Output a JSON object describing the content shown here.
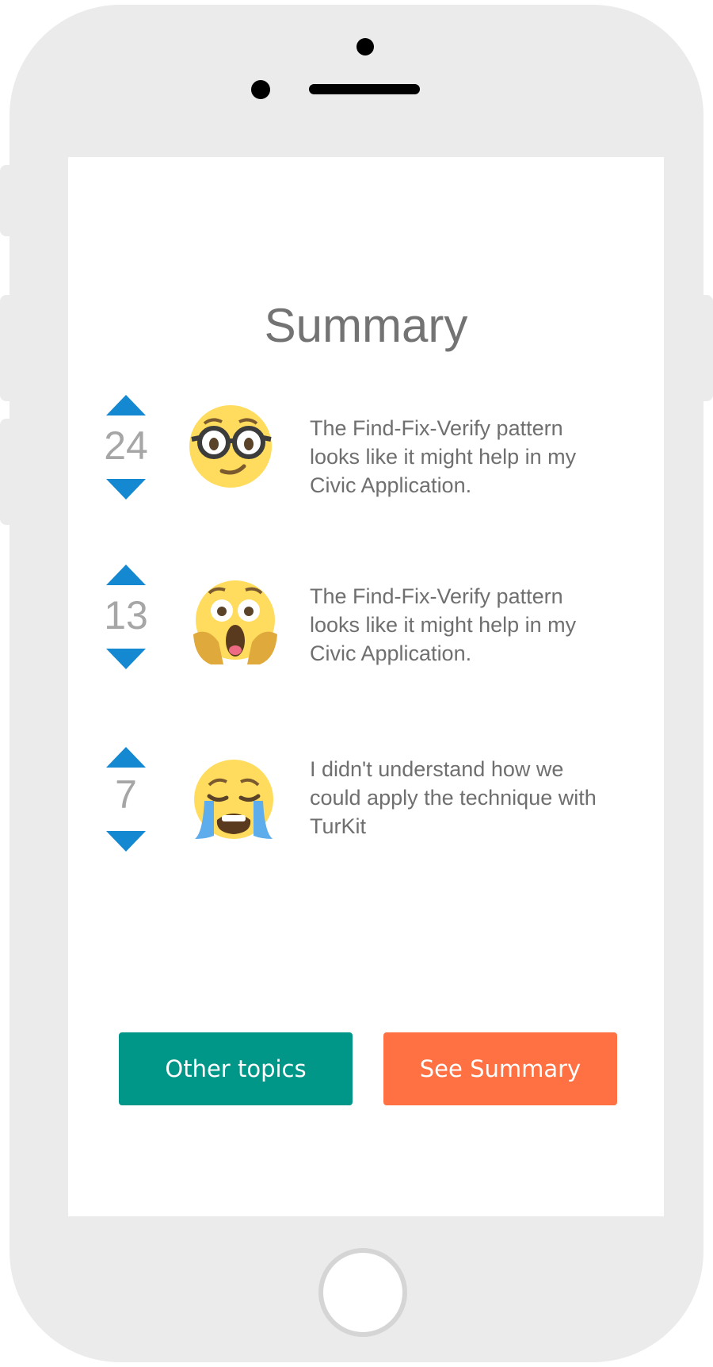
{
  "screen": {
    "title": "Summary"
  },
  "feedback": [
    {
      "count": "24",
      "emoji": "nerd-face-icon",
      "text": "The Find-Fix-Verify pattern looks like it might help in my Civic Application."
    },
    {
      "count": "13",
      "emoji": "scared-face-icon",
      "text": "The Find-Fix-Verify pattern looks like it might help in my Civic Application."
    },
    {
      "count": "7",
      "emoji": "crying-face-icon",
      "text": "I didn't understand how we could apply the technique with TurKit"
    }
  ],
  "buttons": {
    "other_topics": "Other topics",
    "see_summary": "See Summary"
  },
  "colors": {
    "arrow": "#1488d0",
    "other_topics": "#009688",
    "see_summary": "#ff7043",
    "device": "#ebebeb"
  }
}
